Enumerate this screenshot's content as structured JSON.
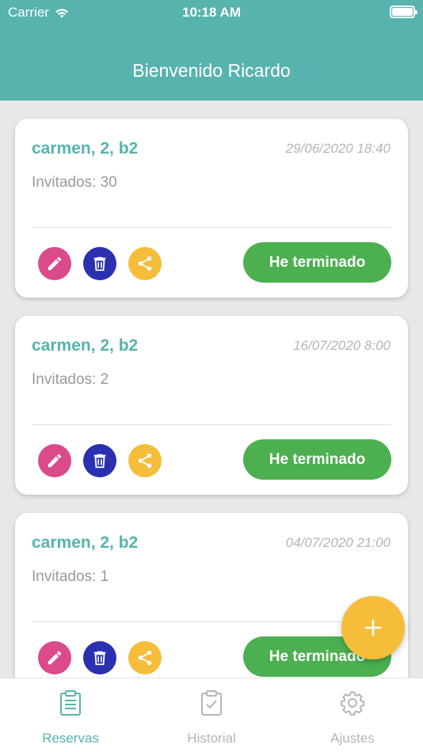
{
  "status_bar": {
    "carrier": "Carrier",
    "time": "10:18 AM"
  },
  "header": {
    "title": "Bienvenido Ricardo"
  },
  "reservations": [
    {
      "address": "carmen, 2, b2",
      "datetime": "29/06/2020 18:40",
      "guests": "Invitados: 30",
      "done_label": "He terminado"
    },
    {
      "address": "carmen, 2, b2",
      "datetime": "16/07/2020 8:00",
      "guests": "Invitados: 2",
      "done_label": "He terminado"
    },
    {
      "address": "carmen, 2, b2",
      "datetime": "04/07/2020 21:00",
      "guests": "Invitados: 1",
      "done_label": "He terminado"
    }
  ],
  "tabs": [
    {
      "label": "Reservas",
      "icon": "clipboard-list-icon",
      "active": true
    },
    {
      "label": "Historial",
      "icon": "clipboard-check-icon",
      "active": false
    },
    {
      "label": "Ajustes",
      "icon": "gear-icon",
      "active": false
    }
  ],
  "colors": {
    "primary": "#57b3ae",
    "edit": "#db4a8b",
    "delete": "#2b30b0",
    "share": "#f5bd3a",
    "done": "#4caf50",
    "fab": "#f5bd3a"
  }
}
